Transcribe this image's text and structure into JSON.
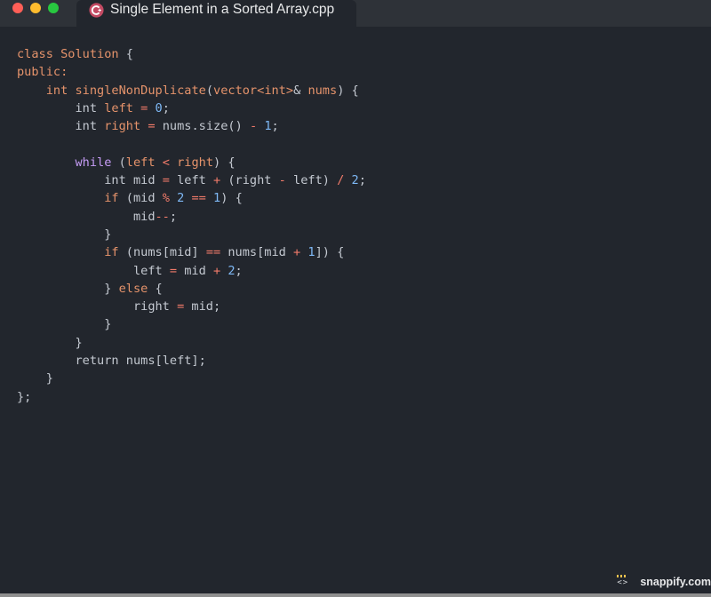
{
  "window": {
    "tab": {
      "title": "Single Element in a Sorted Array.cpp",
      "icon": "cpp-language-icon"
    },
    "traffic_lights": [
      {
        "name": "close",
        "color": "#ff5f57"
      },
      {
        "name": "minimize",
        "color": "#febc2e"
      },
      {
        "name": "maximize",
        "color": "#28c840"
      }
    ]
  },
  "code": {
    "language": "cpp",
    "lines": [
      [
        {
          "t": "class",
          "k": "kw"
        },
        {
          "t": " "
        },
        {
          "t": "Solution",
          "k": "cls"
        },
        {
          "t": " {",
          "k": "pn"
        }
      ],
      [
        {
          "t": "public",
          "k": "kw"
        },
        {
          "t": ":",
          "k": "kw"
        }
      ],
      [
        {
          "t": "    "
        },
        {
          "t": "int",
          "k": "type"
        },
        {
          "t": " "
        },
        {
          "t": "singleNonDuplicate",
          "k": "fn"
        },
        {
          "t": "(",
          "k": "pn"
        },
        {
          "t": "vector",
          "k": "type"
        },
        {
          "t": "<",
          "k": "type"
        },
        {
          "t": "int",
          "k": "type"
        },
        {
          "t": ">",
          "k": "type"
        },
        {
          "t": "&",
          "k": "pn"
        },
        {
          "t": " "
        },
        {
          "t": "nums",
          "k": "var"
        },
        {
          "t": ") {",
          "k": "pn"
        }
      ],
      [
        {
          "t": "        "
        },
        {
          "t": "int",
          "k": "id"
        },
        {
          "t": " "
        },
        {
          "t": "left",
          "k": "var"
        },
        {
          "t": " "
        },
        {
          "t": "=",
          "k": "op"
        },
        {
          "t": " "
        },
        {
          "t": "0",
          "k": "num"
        },
        {
          "t": ";",
          "k": "pn"
        }
      ],
      [
        {
          "t": "        "
        },
        {
          "t": "int",
          "k": "id"
        },
        {
          "t": " "
        },
        {
          "t": "right",
          "k": "var"
        },
        {
          "t": " "
        },
        {
          "t": "=",
          "k": "op"
        },
        {
          "t": " "
        },
        {
          "t": "nums",
          "k": "id"
        },
        {
          "t": ".",
          "k": "pn"
        },
        {
          "t": "size",
          "k": "meth"
        },
        {
          "t": "()",
          "k": "pn"
        },
        {
          "t": " "
        },
        {
          "t": "-",
          "k": "op"
        },
        {
          "t": " "
        },
        {
          "t": "1",
          "k": "num"
        },
        {
          "t": ";",
          "k": "pn"
        }
      ],
      [],
      [
        {
          "t": "        "
        },
        {
          "t": "while",
          "k": "ctrl"
        },
        {
          "t": " (",
          "k": "pn"
        },
        {
          "t": "left",
          "k": "var"
        },
        {
          "t": " "
        },
        {
          "t": "<",
          "k": "op"
        },
        {
          "t": " "
        },
        {
          "t": "right",
          "k": "var"
        },
        {
          "t": ") {",
          "k": "pn"
        }
      ],
      [
        {
          "t": "            "
        },
        {
          "t": "int",
          "k": "id"
        },
        {
          "t": " mid "
        },
        {
          "t": "=",
          "k": "op"
        },
        {
          "t": " left "
        },
        {
          "t": "+",
          "k": "op"
        },
        {
          "t": " (right "
        },
        {
          "t": "-",
          "k": "op"
        },
        {
          "t": " left) "
        },
        {
          "t": "/",
          "k": "op"
        },
        {
          "t": " "
        },
        {
          "t": "2",
          "k": "num"
        },
        {
          "t": ";",
          "k": "pn"
        }
      ],
      [
        {
          "t": "            "
        },
        {
          "t": "if",
          "k": "kw"
        },
        {
          "t": " (mid "
        },
        {
          "t": "%",
          "k": "op"
        },
        {
          "t": " "
        },
        {
          "t": "2",
          "k": "num"
        },
        {
          "t": " "
        },
        {
          "t": "==",
          "k": "op"
        },
        {
          "t": " "
        },
        {
          "t": "1",
          "k": "num"
        },
        {
          "t": ") {",
          "k": "pn"
        }
      ],
      [
        {
          "t": "                mid"
        },
        {
          "t": "--",
          "k": "op"
        },
        {
          "t": ";",
          "k": "pn"
        }
      ],
      [
        {
          "t": "            }",
          "k": "pn"
        }
      ],
      [
        {
          "t": "            "
        },
        {
          "t": "if",
          "k": "kw"
        },
        {
          "t": " (nums[mid] "
        },
        {
          "t": "==",
          "k": "op"
        },
        {
          "t": " nums[mid "
        },
        {
          "t": "+",
          "k": "op"
        },
        {
          "t": " "
        },
        {
          "t": "1",
          "k": "num"
        },
        {
          "t": "]) {",
          "k": "pn"
        }
      ],
      [
        {
          "t": "                left "
        },
        {
          "t": "=",
          "k": "op"
        },
        {
          "t": " mid "
        },
        {
          "t": "+",
          "k": "op"
        },
        {
          "t": " "
        },
        {
          "t": "2",
          "k": "num"
        },
        {
          "t": ";",
          "k": "pn"
        }
      ],
      [
        {
          "t": "            } ",
          "k": "pn"
        },
        {
          "t": "else",
          "k": "kw"
        },
        {
          "t": " {",
          "k": "pn"
        }
      ],
      [
        {
          "t": "                right "
        },
        {
          "t": "=",
          "k": "op"
        },
        {
          "t": " mid;"
        }
      ],
      [
        {
          "t": "            }",
          "k": "pn"
        }
      ],
      [
        {
          "t": "        }",
          "k": "pn"
        }
      ],
      [
        {
          "t": "        "
        },
        {
          "t": "return",
          "k": "ret"
        },
        {
          "t": " nums[left];"
        }
      ],
      [
        {
          "t": "    }",
          "k": "pn"
        }
      ],
      [
        {
          "t": "};",
          "k": "pn"
        }
      ]
    ]
  },
  "branding": {
    "text": "snappify.com",
    "icon": "snappify-logo-icon"
  }
}
